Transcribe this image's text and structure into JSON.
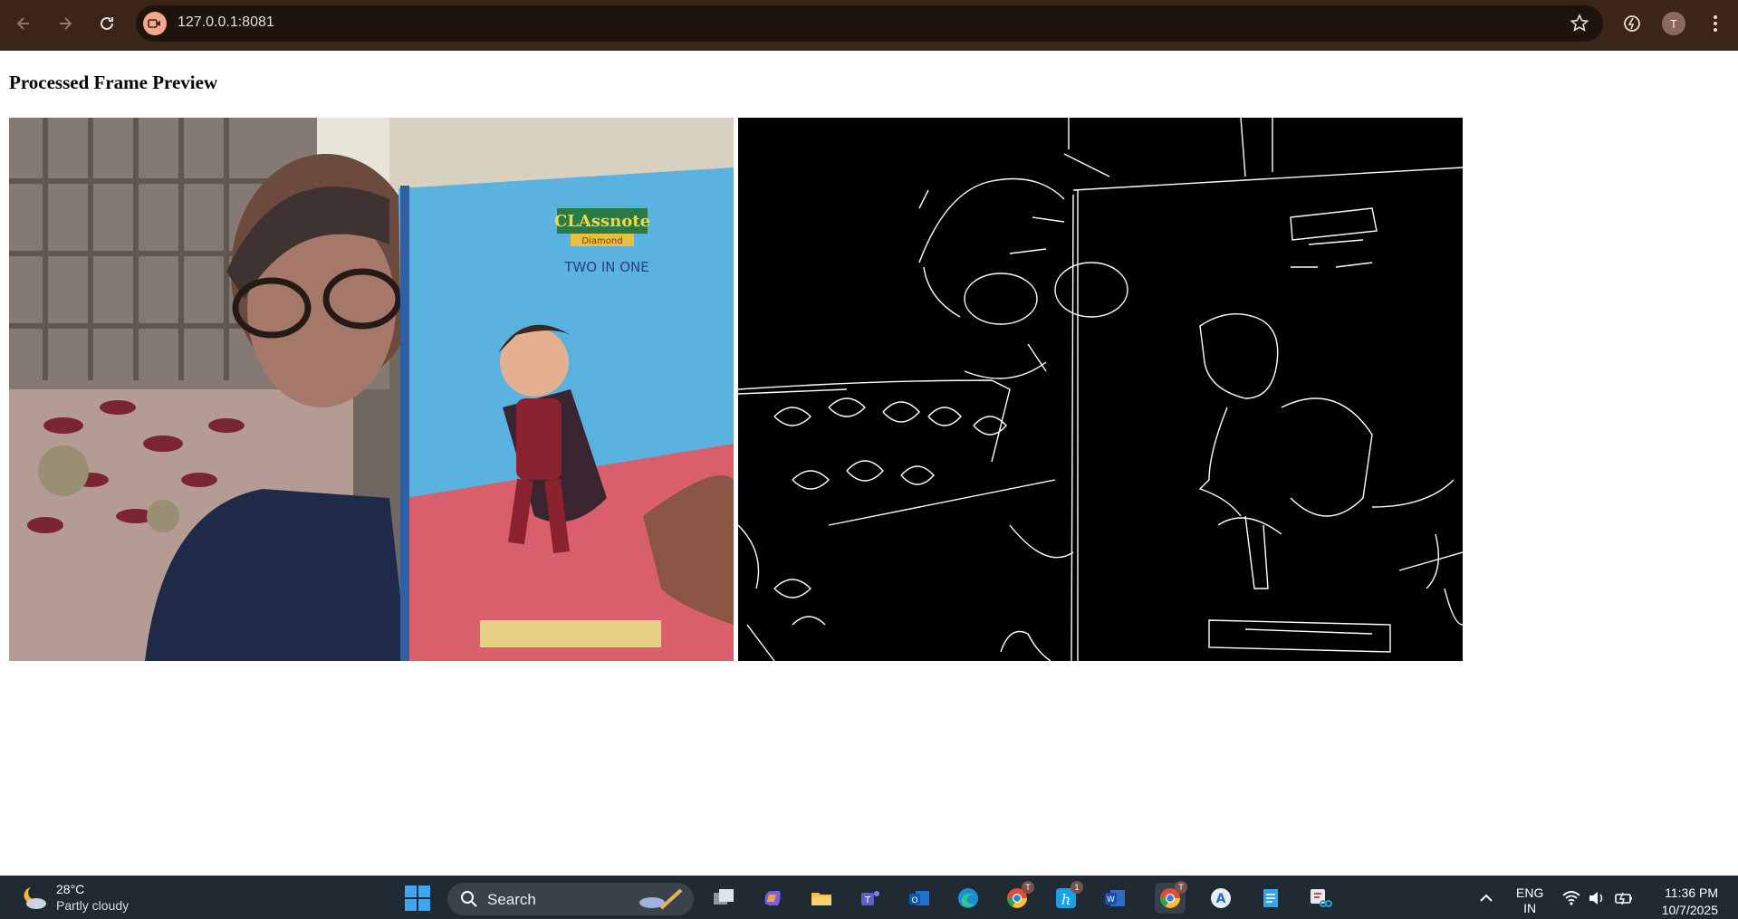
{
  "browser": {
    "url": "127.0.0.1:8081",
    "profile_initial": "T",
    "icons": {
      "back": "back-arrow-icon",
      "forward": "forward-arrow-icon",
      "reload": "reload-icon",
      "site": "camera-icon",
      "bookmark": "star-icon",
      "extension": "extension-icon",
      "menu": "kebab-menu-icon"
    }
  },
  "page": {
    "title": "Processed Frame Preview",
    "images": [
      {
        "name": "original-frame",
        "content": "webcam photo of person holding blue Classnote notebook with cartoon hero cover",
        "printed_text": [
          "CLAssnote",
          "Diamond",
          "TWO IN ONE"
        ]
      },
      {
        "name": "edge-detected-frame",
        "content": "black image with white Canny edge lines of the same scene"
      }
    ]
  },
  "taskbar": {
    "weather": {
      "temp": "28°C",
      "desc": "Partly cloudy",
      "icon": "partly-cloudy-moon-icon"
    },
    "search_label": "Search",
    "apps": [
      {
        "name": "task-view",
        "icon": "task-view-icon"
      },
      {
        "name": "copilot",
        "icon": "copilot-icon"
      },
      {
        "name": "file-explorer",
        "icon": "folder-icon"
      },
      {
        "name": "teams",
        "icon": "teams-icon"
      },
      {
        "name": "outlook",
        "icon": "outlook-icon"
      },
      {
        "name": "edge",
        "icon": "edge-icon"
      },
      {
        "name": "chrome-1",
        "icon": "chrome-icon",
        "badge": "T"
      },
      {
        "name": "hyperlink-app",
        "icon": "h-app-icon",
        "badge": "1"
      },
      {
        "name": "word",
        "icon": "word-icon"
      },
      {
        "name": "chrome-2",
        "icon": "chrome-icon",
        "badge": "T"
      },
      {
        "name": "app-store",
        "icon": "app-a-icon"
      },
      {
        "name": "notepad",
        "icon": "notepad-icon"
      },
      {
        "name": "snipping-tool",
        "icon": "snipping-tool-icon"
      }
    ],
    "lang_line1": "ENG",
    "lang_line2": "IN",
    "time": "11:36 PM",
    "date": "10/7/2025"
  }
}
